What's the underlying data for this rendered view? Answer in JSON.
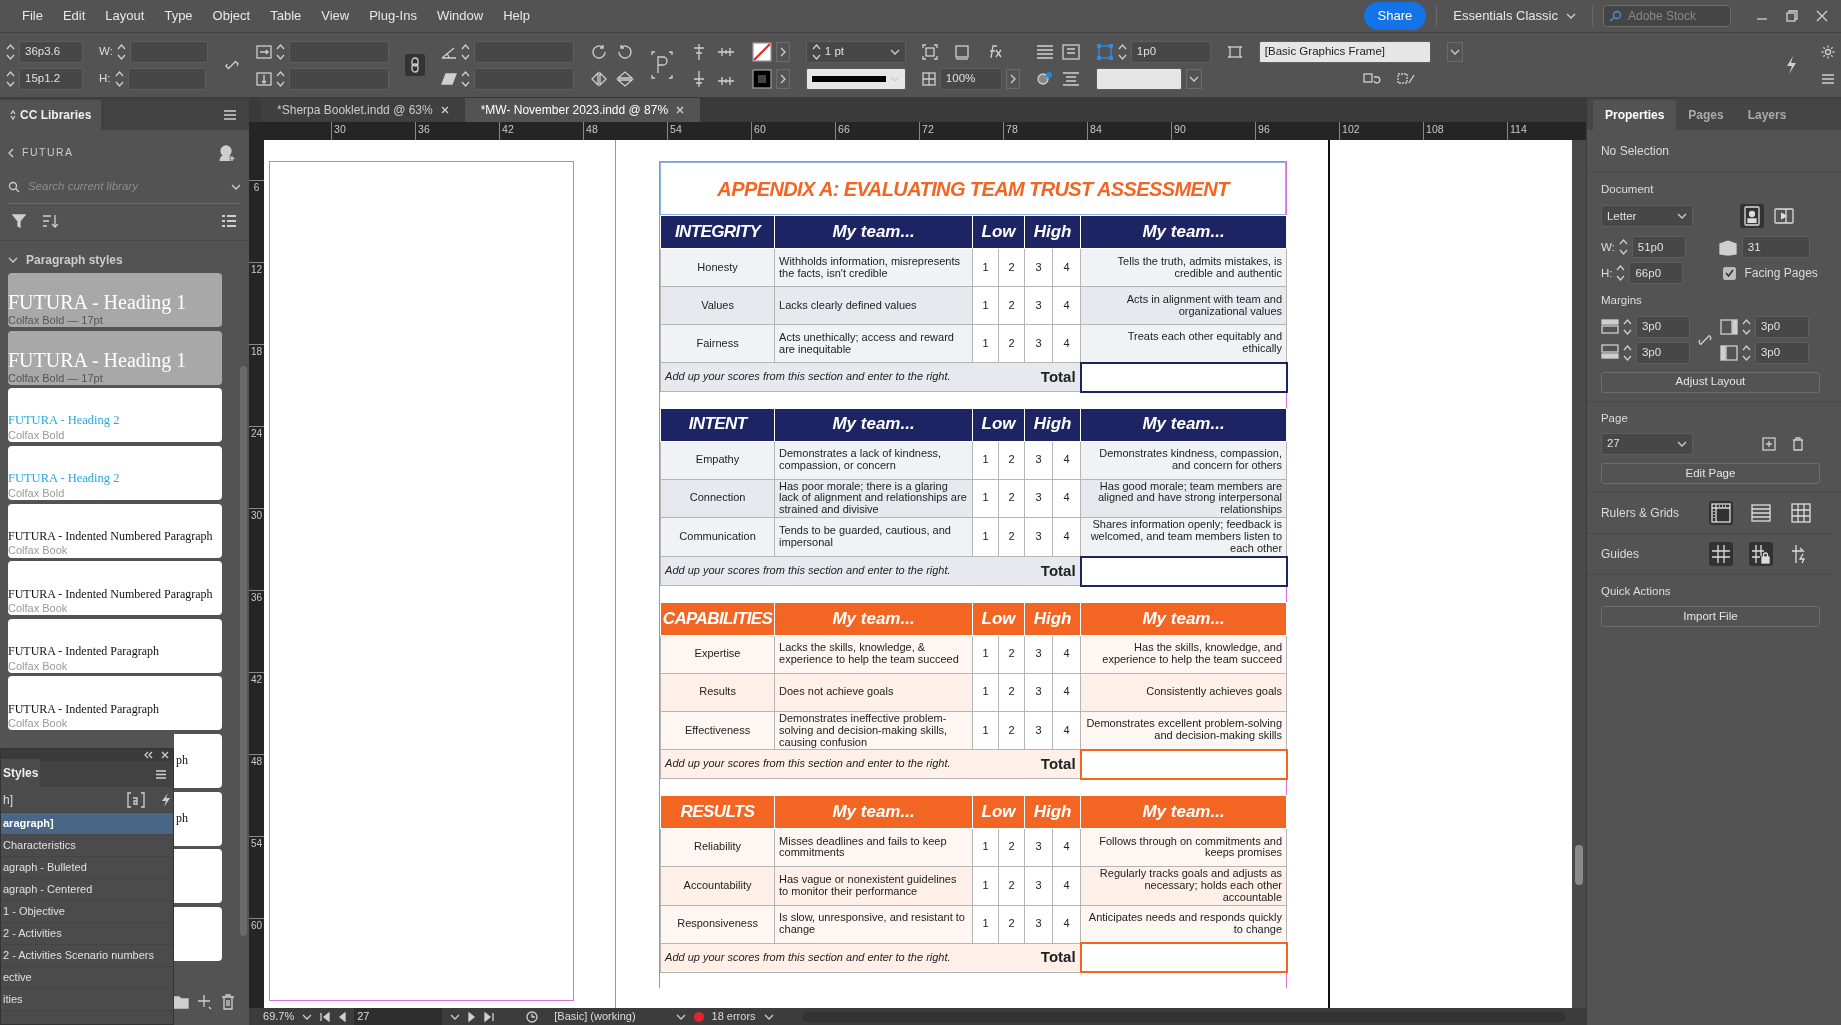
{
  "menu_bar": [
    "File",
    "Edit",
    "Layout",
    "Type",
    "Object",
    "Table",
    "View",
    "Plug-Ins",
    "Window",
    "Help"
  ],
  "title_bar": {
    "share": "Share",
    "workspace": "Essentials Classic",
    "search_placeholder": "Adobe Stock"
  },
  "control_bar": {
    "x": "36p3.6",
    "y": "15p1.2",
    "w_label": "W:",
    "h_label": "H:",
    "stroke_weight": "1 pt",
    "opacity": "100%",
    "offset": "1p0",
    "object_style": "[Basic Graphics Frame]"
  },
  "left_panel": {
    "tab": "CC Libraries",
    "library": "FUTURA",
    "search_placeholder": "Search current library",
    "section": "Paragraph styles",
    "styles": [
      {
        "kind": "heading1",
        "name": "FUTURA - Heading 1",
        "detail": "Colfax Bold — 17pt"
      },
      {
        "kind": "heading1",
        "name": "FUTURA - Heading 1",
        "detail": "Colfax Bold — 17pt"
      },
      {
        "kind": "heading2",
        "name": "FUTURA - Heading 2",
        "detail": "Colfax Bold"
      },
      {
        "kind": "heading2",
        "name": "FUTURA - Heading 2",
        "detail": "Colfax Bold"
      },
      {
        "kind": "body",
        "name": "FUTURA - Indented Numbered Paragraph",
        "detail": "Colfax Book"
      },
      {
        "kind": "body",
        "name": "FUTURA - Indented Numbered Paragraph",
        "detail": "Colfax Book"
      },
      {
        "kind": "body",
        "name": "FUTURA - Indented Paragraph",
        "detail": "Colfax Book"
      },
      {
        "kind": "body",
        "name": "FUTURA - Indented Paragraph",
        "detail": "Colfax Book"
      },
      {
        "kind": "covered",
        "name": "ph"
      },
      {
        "kind": "covered",
        "name": "ph"
      },
      {
        "kind": "covered"
      },
      {
        "kind": "covered"
      }
    ]
  },
  "styles_panel": {
    "tab": "Styles",
    "current": "h]",
    "items": [
      {
        "label": "aragraph]",
        "selected": true
      },
      {
        "label": "Characteristics",
        "selected": false
      },
      {
        "label": "agraph - Bulleted",
        "selected": false
      },
      {
        "label": "agraph - Centered",
        "selected": false
      },
      {
        "label": "1 - Objective",
        "selected": false
      },
      {
        "label": "2 - Activities",
        "selected": false
      },
      {
        "label": "2 - Activities Scenario numbers",
        "selected": false
      },
      {
        "label": "ective",
        "selected": false
      },
      {
        "label": "ities",
        "selected": false
      }
    ]
  },
  "document_tabs": [
    {
      "label": "*Sherpa Booklet.indd @ 63%",
      "selected": false
    },
    {
      "label": "*MW- November 2023.indd @ 87%",
      "selected": true
    }
  ],
  "ruler_h": [
    "30",
    "36",
    "42",
    "48",
    "54",
    "60",
    "66",
    "72",
    "78",
    "84",
    "90",
    "96",
    "102",
    "108",
    "114"
  ],
  "ruler_v": [
    "6",
    "12",
    "18",
    "24",
    "30",
    "36",
    "42",
    "48",
    "54",
    "60"
  ],
  "document": {
    "title": "APPENDIX A: EVALUATING TEAM TRUST ASSESSMENT",
    "sections": [
      {
        "category": "INTEGRITY",
        "color": "#1c2463",
        "col_left": "My team...",
        "low": "Low",
        "high": "High",
        "col_right": "My team...",
        "rows": [
          {
            "label": "Honesty",
            "left": "Withholds information, misrepresents the facts, isn't credible",
            "scale": [
              "1",
              "2",
              "3",
              "4"
            ],
            "right": "Tells the truth, admits mistakes, is credible and authentic"
          },
          {
            "label": "Values",
            "left": "Lacks clearly defined values",
            "scale": [
              "1",
              "2",
              "3",
              "4"
            ],
            "right": "Acts in alignment with team and organizational values"
          },
          {
            "label": "Fairness",
            "left": "Acts unethically; access and reward are inequitable",
            "scale": [
              "1",
              "2",
              "3",
              "4"
            ],
            "right": "Treats each other equitably and ethically"
          }
        ],
        "total_note": "Add up your scores from this section and enter to the right.",
        "total_label": "Total"
      },
      {
        "category": "INTENT",
        "color": "#1c2463",
        "col_left": "My team...",
        "low": "Low",
        "high": "High",
        "col_right": "My team...",
        "rows": [
          {
            "label": "Empathy",
            "left": "Demonstrates a lack of kindness, compassion, or concern",
            "scale": [
              "1",
              "2",
              "3",
              "4"
            ],
            "right": "Demonstrates kindness, compassion, and concern for others"
          },
          {
            "label": "Connection",
            "left": "Has poor morale; there is a glaring lack of alignment and relationships are strained and divisive",
            "scale": [
              "1",
              "2",
              "3",
              "4"
            ],
            "right": "Has good morale; team members are aligned and have strong interpersonal relationships"
          },
          {
            "label": "Communication",
            "left": "Tends to be guarded, cautious, and impersonal",
            "scale": [
              "1",
              "2",
              "3",
              "4"
            ],
            "right": "Shares information openly; feedback is welcomed, and team members listen to each other"
          }
        ],
        "total_note": "Add up your scores from this section and enter to the right.",
        "total_label": "Total"
      },
      {
        "category": "CAPABILITIES",
        "color": "#f26522",
        "col_left": "My team...",
        "low": "Low",
        "high": "High",
        "col_right": "My team...",
        "rows": [
          {
            "label": "Expertise",
            "left": "Lacks the skills, knowledge, & experience to help the team succeed",
            "scale": [
              "1",
              "2",
              "3",
              "4"
            ],
            "right": "Has the skills, knowledge, and experience to help the team succeed"
          },
          {
            "label": "Results",
            "left": "Does not achieve goals",
            "scale": [
              "1",
              "2",
              "3",
              "4"
            ],
            "right": "Consistently achieves goals"
          },
          {
            "label": "Effectiveness",
            "left": "Demonstrates ineffective problem-solving and decision-making skills, causing confusion",
            "scale": [
              "1",
              "2",
              "3",
              "4"
            ],
            "right": "Demonstrates excellent problem-solving and decision-making skills"
          }
        ],
        "total_note": "Add up your scores from this section and enter to the right.",
        "total_label": "Total"
      },
      {
        "category": "RESULTS",
        "color": "#f26522",
        "col_left": "My team...",
        "low": "Low",
        "high": "High",
        "col_right": "My team...",
        "rows": [
          {
            "label": "Reliability",
            "left": "Misses deadlines and fails to keep commitments",
            "scale": [
              "1",
              "2",
              "3",
              "4"
            ],
            "right": "Follows through on commitments and keeps promises"
          },
          {
            "label": "Accountability",
            "left": "Has vague or nonexistent guidelines to monitor their performance",
            "scale": [
              "1",
              "2",
              "3",
              "4"
            ],
            "right": "Regularly tracks goals and adjusts as necessary; holds each other accountable"
          },
          {
            "label": "Responsiveness",
            "left": "Is slow, unresponsive, and resistant to change",
            "scale": [
              "1",
              "2",
              "3",
              "4"
            ],
            "right": "Anticipates needs and responds quickly to change"
          }
        ],
        "total_note": "Add up your scores from this section and enter to the right.",
        "total_label": "Total"
      }
    ]
  },
  "properties_panel": {
    "tabs": [
      {
        "label": "Properties",
        "selected": true
      },
      {
        "label": "Pages",
        "selected": false
      },
      {
        "label": "Layers",
        "selected": false
      }
    ],
    "selection": "No Selection",
    "document_heading": "Document",
    "page_size": "Letter",
    "orientation_buttons": [
      {
        "kind": "portrait",
        "selected": true
      },
      {
        "kind": "landscape",
        "selected": false
      }
    ],
    "w_label": "W:",
    "width": "51p0",
    "h_label": "H:",
    "height": "66p0",
    "pages": "31",
    "facing_pages": {
      "label": "Facing Pages",
      "checked": true
    },
    "margins_heading": "Margins",
    "margins": [
      "3p0",
      "3p0",
      "3p0",
      "3p0"
    ],
    "adjust_layout": "Adjust Layout",
    "page_heading": "Page",
    "page": "27",
    "edit_page": "Edit Page",
    "rulers_heading": "Rulers & Grids",
    "rulers_buttons": [
      {
        "kind": "rulers",
        "selected": true
      },
      {
        "kind": "baseline",
        "selected": false
      },
      {
        "kind": "grid",
        "selected": false
      }
    ],
    "guides_heading": "Guides",
    "guides_buttons": [
      {
        "kind": "guides",
        "selected": true
      },
      {
        "kind": "lock",
        "selected": true
      },
      {
        "kind": "smart",
        "selected": false
      }
    ],
    "quick_actions_heading": "Quick Actions",
    "import_file": "Import File"
  },
  "status_bar": {
    "zoom": "69.7%",
    "page": "27",
    "preflight_profile": "[Basic] (working)",
    "errors": "18 errors"
  }
}
